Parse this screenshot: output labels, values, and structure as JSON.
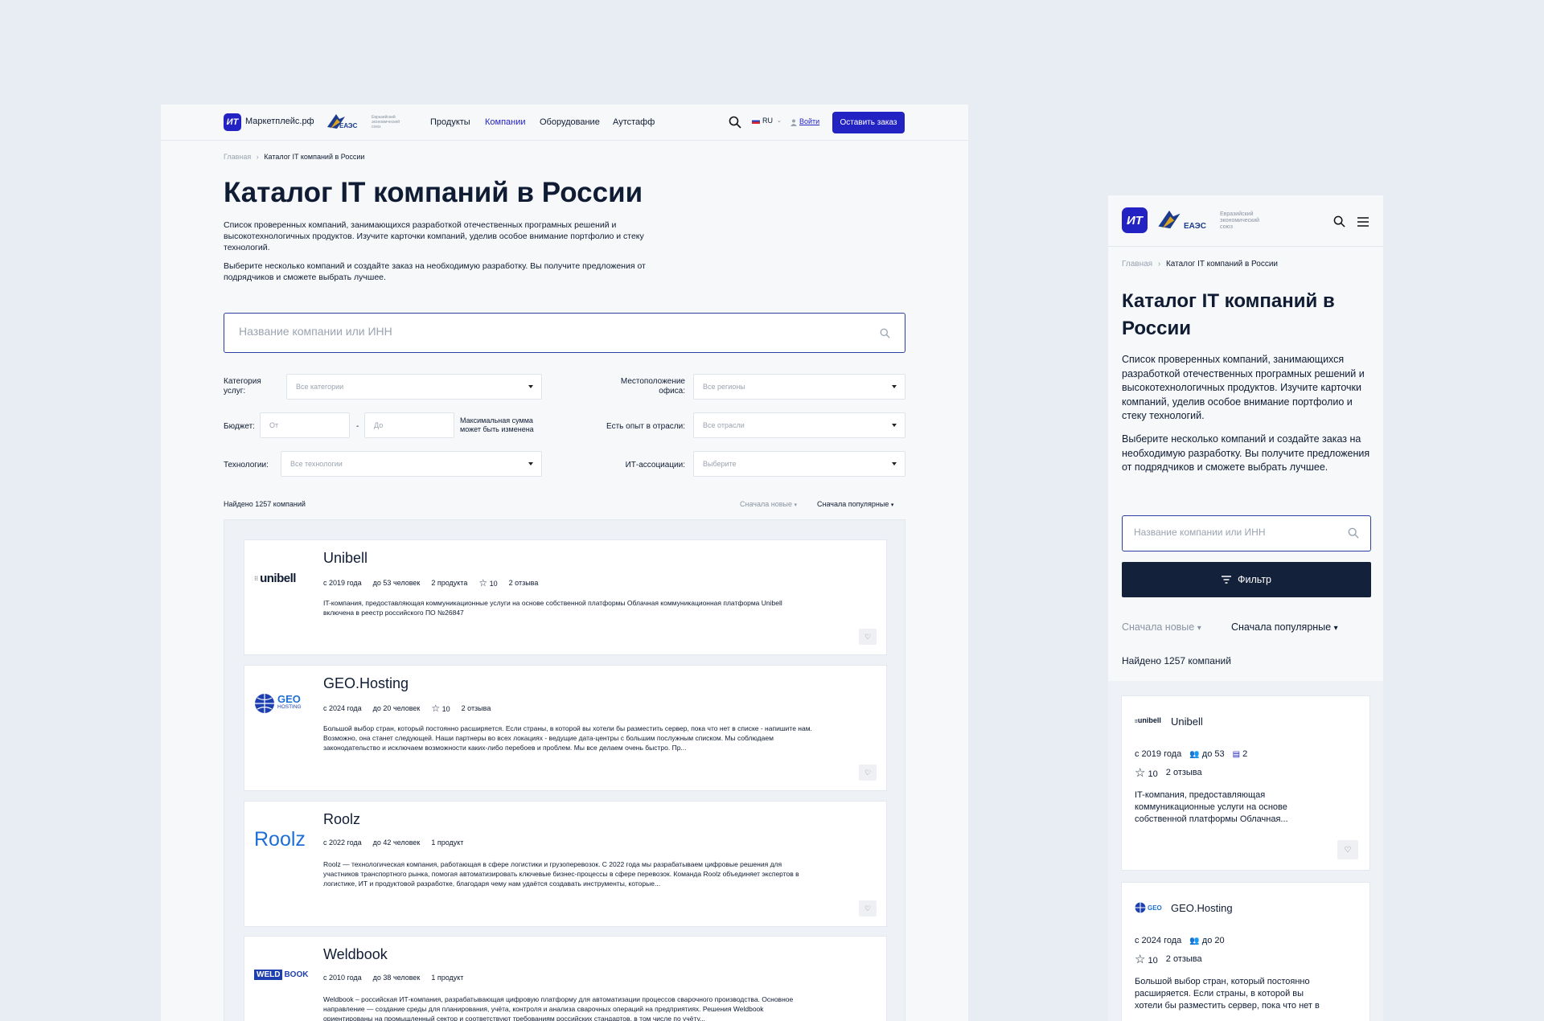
{
  "desktop": {
    "header": {
      "logo_text": "ИТ",
      "brand": "Маркетплейс.рф",
      "eaeu_short": "ЕАЭС",
      "eaeu_caption": "Евразийский экономический союз",
      "nav": [
        "Продукты",
        "Компании",
        "Оборудование",
        "Аутстафф"
      ],
      "lang": "RU",
      "login": "Войти",
      "cta": "Оставить заказ"
    },
    "breadcrumb": {
      "home": "Главная",
      "current": "Каталог IT компаний в России"
    },
    "title": "Каталог IT компаний в России",
    "intro1": "Список проверенных компаний, занимающихся разработкой отечественных програмных решений и высокотехнологичных продуктов. Изучите карточки компаний, уделив особое внимание портфолио и стеку технологий.",
    "intro2": "Выберите несколько компаний и создайте заказ на необходимую разработку. Вы получите предложения от подрядчиков и сможете выбрать лучшее.",
    "search_placeholder": "Название компании или ИНН",
    "filters": {
      "category_label": "Категория услуг:",
      "category_value": "Все категории",
      "location_label": "Местоположение офиса:",
      "location_value": "Все регионы",
      "budget_label": "Бюджет:",
      "budget_from": "От",
      "budget_dash": "-",
      "budget_to": "До",
      "budget_note": "Максимальная сумма может быть изменена",
      "industry_label": "Есть опыт в отрасли:",
      "industry_value": "Все отрасли",
      "tech_label": "Технологии:",
      "tech_value": "Все технологии",
      "assoc_label": "ИТ-ассоциации:",
      "assoc_value": "Выберите"
    },
    "found": "Найдено 1257 компаний",
    "sort_new": "Сначала новые",
    "sort_popular": "Сначала популярные",
    "companies": [
      {
        "name": "Unibell",
        "logo": "unibell",
        "since": "с 2019 года",
        "staff": "до 53 человек",
        "products": "2 продукта",
        "rating": "10",
        "reviews": "2 отзыва",
        "desc": "IT-компания, предоставляющая коммуникационные услуги на основе собственной платформы Облачная коммуникационная платформа Unibell включена в реестр российского ПО №26847"
      },
      {
        "name": "GEO.Hosting",
        "logo": "GEO",
        "logo_sub": "HOSTING",
        "since": "с 2024 года",
        "staff": "до 20 человек",
        "rating": "10",
        "reviews": "2 отзыва",
        "desc": "Большой выбор стран, который постоянно расширяется. Если страны, в которой вы хотели бы разместить сервер, пока что нет в списке - напишите нам. Возможно, она станет следующей. Наши партнеры во всех локациях - ведущие дата-центры с большим послужным списком. Мы соблюдаем законодательство и исключаем возможности каких-либо перебоев и проблем. Мы все делаем очень быстро. Пр..."
      },
      {
        "name": "Roolz",
        "logo": "Roolz",
        "since": "с 2022 года",
        "staff": "до 42 человек",
        "products": "1 продукт",
        "desc": "Roolz — технологическая компания, работающая в сфере логистики и грузоперевозок. С 2022 года мы разрабатываем цифровые решения для участников транспортного рынка, помогая автоматизировать ключевые бизнес-процессы в сфере перевозок. Команда Roolz объединяет экспертов в логистике, ИТ и продуктовой разработке, благодаря чему нам удаётся создавать инструменты, которые..."
      },
      {
        "name": "Weldbook",
        "logo": "WELD",
        "logo_sub": "BOOK",
        "since": "с 2010 года",
        "staff": "до 38 человек",
        "products": "1 продукт",
        "desc": "Weldbook – российская ИТ-компания, разрабатывающая цифровую платформу для автоматизации процессов сварочного производства. Основное направление — создание среды для планирования, учёта, контроля и анализа сварочных операций на предприятиях. Решения Weldbook ориентированы на промышленный сектор и соответствуют требованиям российских стандартов, в том числе по учёту..."
      }
    ]
  },
  "mobile": {
    "logo_text": "ИТ",
    "eaeu_short": "ЕАЭС",
    "eaeu_caption": "Евразийский экономический союз",
    "breadcrumb": {
      "home": "Главная",
      "current": "Каталог IT компаний в России"
    },
    "title": "Каталог IT компаний в России",
    "intro1": "Список проверенных компаний, занимающихся разработкой отечественных програмных решений и высокотехнологичных продуктов. Изучите карточки компаний, уделив особое внимание портфолио и стеку технологий.",
    "intro2": "Выберите несколько компаний и создайте заказ на необходимую разработку. Вы получите предложения от подрядчиков и сможете выбрать лучшее.",
    "search_placeholder": "Название компании или ИНН",
    "filter_button": "Фильтр",
    "sort_new": "Сначала новые",
    "sort_popular": "Сначала популярные",
    "found": "Найдено 1257 компаний",
    "companies": [
      {
        "name": "Unibell",
        "logo": "unibell",
        "since": "с 2019 года",
        "staff": "до 53",
        "products": "2",
        "rating": "10",
        "reviews": "2 отзыва",
        "desc": "IT-компания, предоставляющая коммуникационные услуги на основе собственной платформы Облачная..."
      },
      {
        "name": "GEO.Hosting",
        "logo": "GEO",
        "logo_sub": "HOSTING",
        "since": "с 2024 года",
        "staff": "до 20",
        "rating": "10",
        "reviews": "2 отзыва",
        "desc": "Большой выбор стран, который постоянно расширяется. Если страны, в которой вы хотели бы разместить сервер, пока что нет в списке -..."
      }
    ]
  },
  "colors": {
    "accent": "#2323c4",
    "dark": "#13213a",
    "bg": "#e7edf3"
  }
}
